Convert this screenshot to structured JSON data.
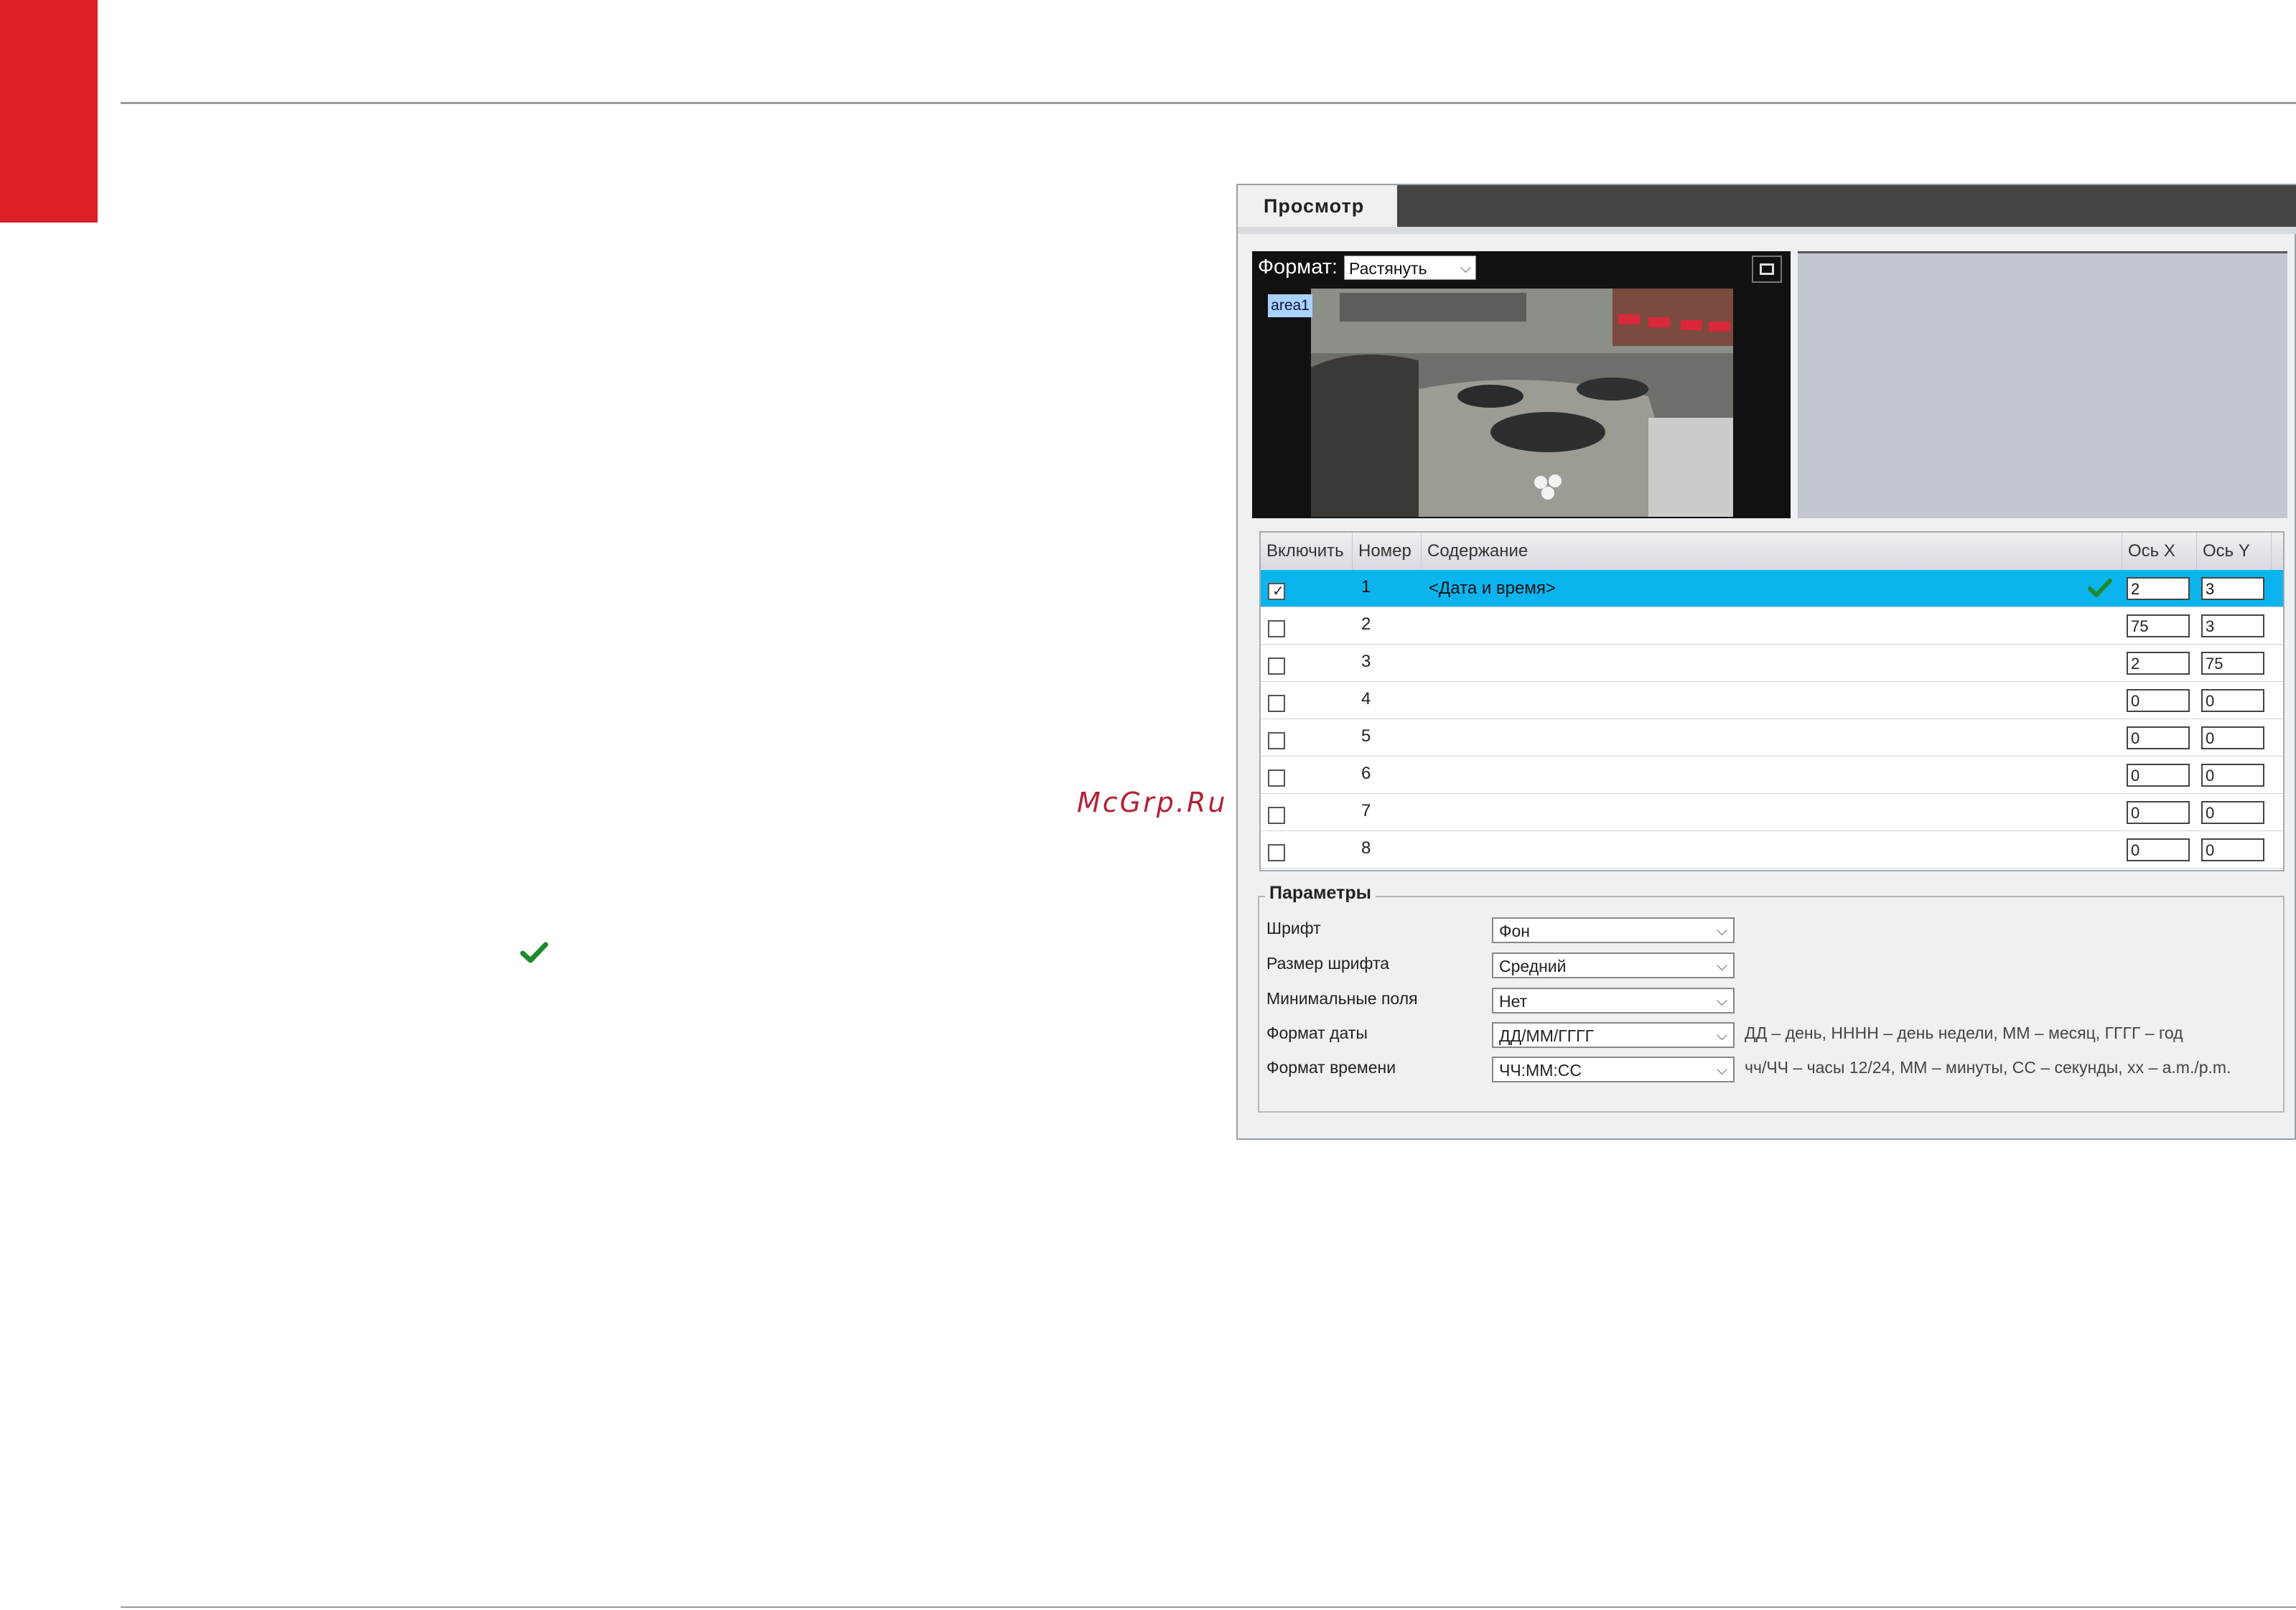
{
  "page": {
    "watermark": "McGrp.Ru"
  },
  "window": {
    "tabs": [
      {
        "label": "Просмотр",
        "active": true
      }
    ]
  },
  "viewer": {
    "format_label": "Формат:",
    "format_value": "Растянуть",
    "area_label": "area1",
    "fullscreen_icon": "fullscreen-icon"
  },
  "osd_table": {
    "columns": [
      "Включить",
      "Номер",
      "Содержание",
      "Ось X",
      "Ось Y"
    ],
    "rows": [
      {
        "enabled": true,
        "number": "1",
        "content": "<Дата и время>",
        "x": "2",
        "y": "3",
        "selected": true,
        "status_icon": "checkmark-icon"
      },
      {
        "enabled": false,
        "number": "2",
        "content": "",
        "x": "75",
        "y": "3"
      },
      {
        "enabled": false,
        "number": "3",
        "content": "",
        "x": "2",
        "y": "75"
      },
      {
        "enabled": false,
        "number": "4",
        "content": "",
        "x": "0",
        "y": "0"
      },
      {
        "enabled": false,
        "number": "5",
        "content": "",
        "x": "0",
        "y": "0"
      },
      {
        "enabled": false,
        "number": "6",
        "content": "",
        "x": "0",
        "y": "0"
      },
      {
        "enabled": false,
        "number": "7",
        "content": "",
        "x": "0",
        "y": "0"
      },
      {
        "enabled": false,
        "number": "8",
        "content": "",
        "x": "0",
        "y": "0"
      }
    ]
  },
  "params": {
    "title": "Параметры",
    "fields": [
      {
        "label": "Шрифт",
        "value": "Фон",
        "hint": ""
      },
      {
        "label": "Размер шрифта",
        "value": "Средний",
        "hint": ""
      },
      {
        "label": "Минимальные поля",
        "value": "Нет",
        "hint": ""
      },
      {
        "label": "Формат даты",
        "value": "ДД/ММ/ГГГГ",
        "hint": "ДД – день, НННН – день недели, ММ – месяц, ГГГГ – год"
      },
      {
        "label": "Формат времени",
        "value": "ЧЧ:ММ:СС",
        "hint": "чч/ЧЧ – часы 12/24, ММ – минуты, СС – секунды, хх – a.m./p.m."
      }
    ]
  },
  "colors": {
    "brand_red": "#dc2026",
    "selected_row": "#0cb4ee",
    "check_green": "#1f8a2c"
  }
}
